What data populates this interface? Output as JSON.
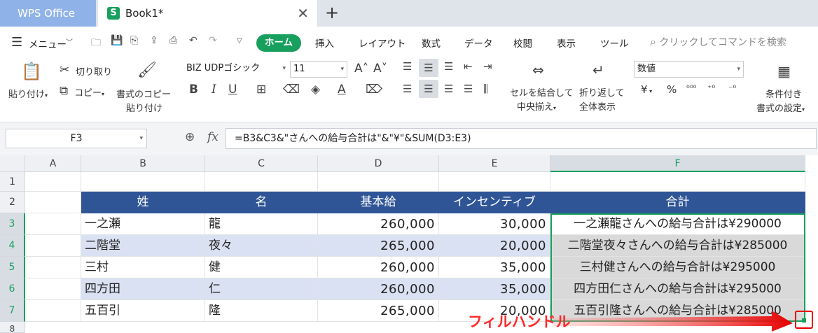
{
  "tabs": {
    "wps": "WPS Office",
    "book": "Book1*",
    "close": "✕",
    "add": "+"
  },
  "menu": {
    "menu_label": "メニュー",
    "tabs": [
      "ホーム",
      "挿入",
      "レイアウト",
      "数式",
      "データ",
      "校閲",
      "表示",
      "ツール"
    ],
    "search_placeholder": "クリックしてコマンドを検索"
  },
  "ribbon": {
    "paste": "貼り付け",
    "cut": "切り取り",
    "copy": "コピー",
    "format_copy_1": "書式のコピー",
    "format_copy_2": "貼り付け",
    "font_name": "BIZ UDPゴシック",
    "font_size": "11",
    "merge_1": "セルを結合して",
    "merge_2": "中央揃え",
    "wrap_1": "折り返して",
    "wrap_2": "全体表示",
    "number_format": "数値",
    "currency": "¥",
    "percent": "%",
    "cond_1": "条件付き",
    "cond_2": "書式の設定"
  },
  "formula_bar": {
    "cell_ref": "F3",
    "formula": "=B3&C3&\"さんへの給与合計は\"&\"¥\"&SUM(D3:E3)"
  },
  "sheet": {
    "columns": [
      "A",
      "B",
      "C",
      "D",
      "E",
      "F"
    ],
    "rows": [
      "1",
      "2",
      "3",
      "4",
      "5",
      "6",
      "7",
      "8"
    ],
    "header": [
      "姓",
      "名",
      "基本給",
      "インセンティブ",
      "合計"
    ],
    "data": [
      [
        "一之瀬",
        "龍",
        "260,000",
        "30,000",
        "一之瀬龍さんへの給与合計は¥290000"
      ],
      [
        "二階堂",
        "夜々",
        "265,000",
        "20,000",
        "二階堂夜々さんへの給与合計は¥285000"
      ],
      [
        "三村",
        "健",
        "260,000",
        "35,000",
        "三村健さんへの給与合計は¥295000"
      ],
      [
        "四方田",
        "仁",
        "260,000",
        "35,000",
        "四方田仁さんへの給与合計は¥295000"
      ],
      [
        "五百引",
        "隆",
        "265,000",
        "20,000",
        "五百引隆さんへの給与合計は¥285000"
      ]
    ],
    "annotation": "フィルハンドル"
  },
  "colors": {
    "accent": "#17a05d",
    "header_fill": "#2f5597",
    "band_fill": "#d9e1f2",
    "annotation": "#ff2a2a"
  }
}
